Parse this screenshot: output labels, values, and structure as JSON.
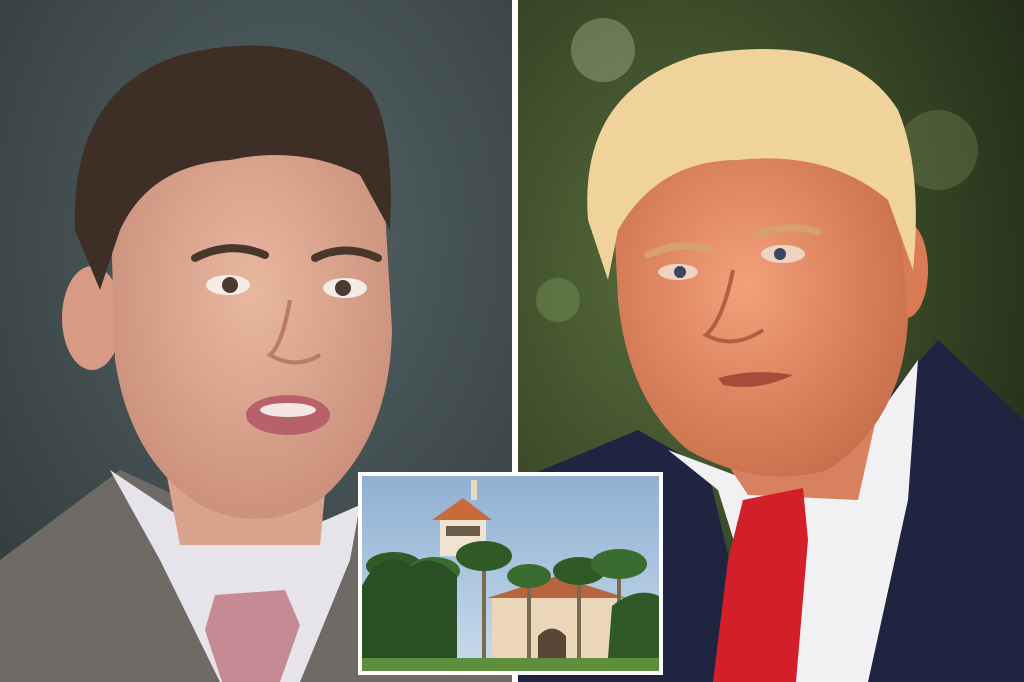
{
  "image": {
    "kind": "photo-collage",
    "panels": [
      {
        "name": "left-portrait",
        "subject": "young-man-in-grey-suit",
        "background_color": "#3e4a4c"
      },
      {
        "name": "right-portrait",
        "subject": "older-man-in-navy-coat-red-tie",
        "background_color": "#2e3a22"
      },
      {
        "name": "inset-estate",
        "subject": "palm-trees-and-mansion-tower",
        "sky_color": "#a9c3dd"
      }
    ],
    "colors": {
      "divider": "#ffffff",
      "tie_left": "#c58a92",
      "tie_right": "#d21f2a",
      "coat_right": "#1f2540",
      "suit_left": "#6e6a66"
    }
  }
}
